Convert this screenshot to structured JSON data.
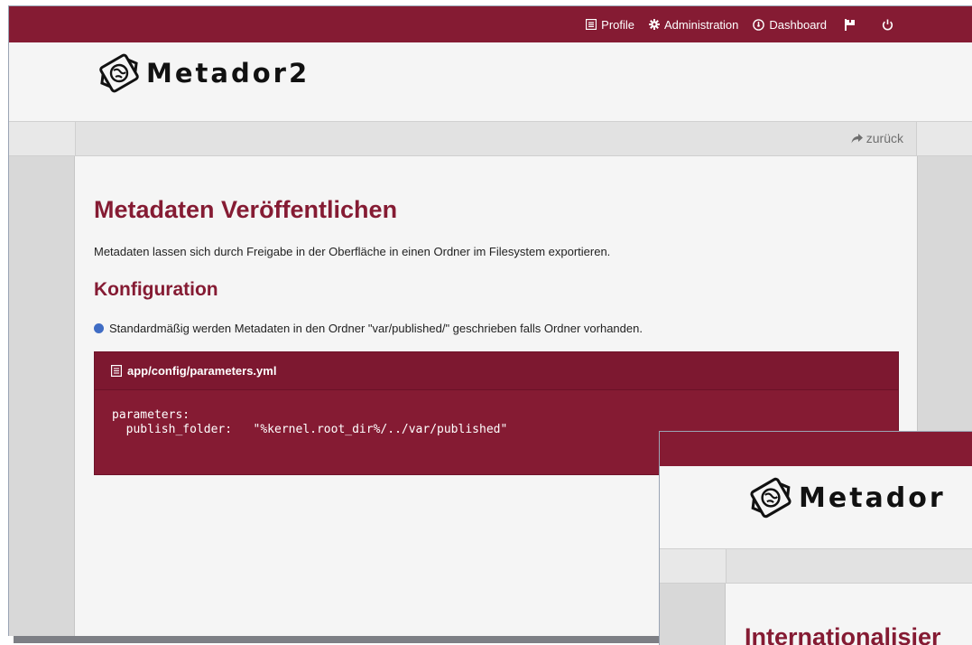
{
  "topnav": {
    "profile_label": "Profile",
    "administration_label": "Administration",
    "dashboard_label": "Dashboard"
  },
  "brand": {
    "logo_text": "Metador2",
    "color_primary": "#851b33"
  },
  "subbar": {
    "back_label": "zurück"
  },
  "main": {
    "title": "Metadaten Veröffentlichen",
    "intro": "Metadaten lassen sich durch Freigabe in der Oberfläche in einen Ordner im Filesystem exportieren.",
    "section_title": "Konfiguration",
    "bullet_text": "Standardmäßig werden Metadaten in den Ordner \"var/published/\" geschrieben falls Ordner vorhanden.",
    "code_panel": {
      "filename": "app/config/parameters.yml",
      "line1": "parameters:",
      "line2": "  publish_folder:   \"%kernel.root_dir%/../var/published\""
    }
  },
  "second_window": {
    "logo_text": "Metador",
    "title": "Internationalisier"
  },
  "icons": {
    "profile": "list-icon",
    "administration": "gear-icon",
    "dashboard": "dashboard-icon",
    "flag": "flag-icon",
    "power": "power-icon",
    "back": "share-arrow-icon",
    "file": "file-icon"
  }
}
